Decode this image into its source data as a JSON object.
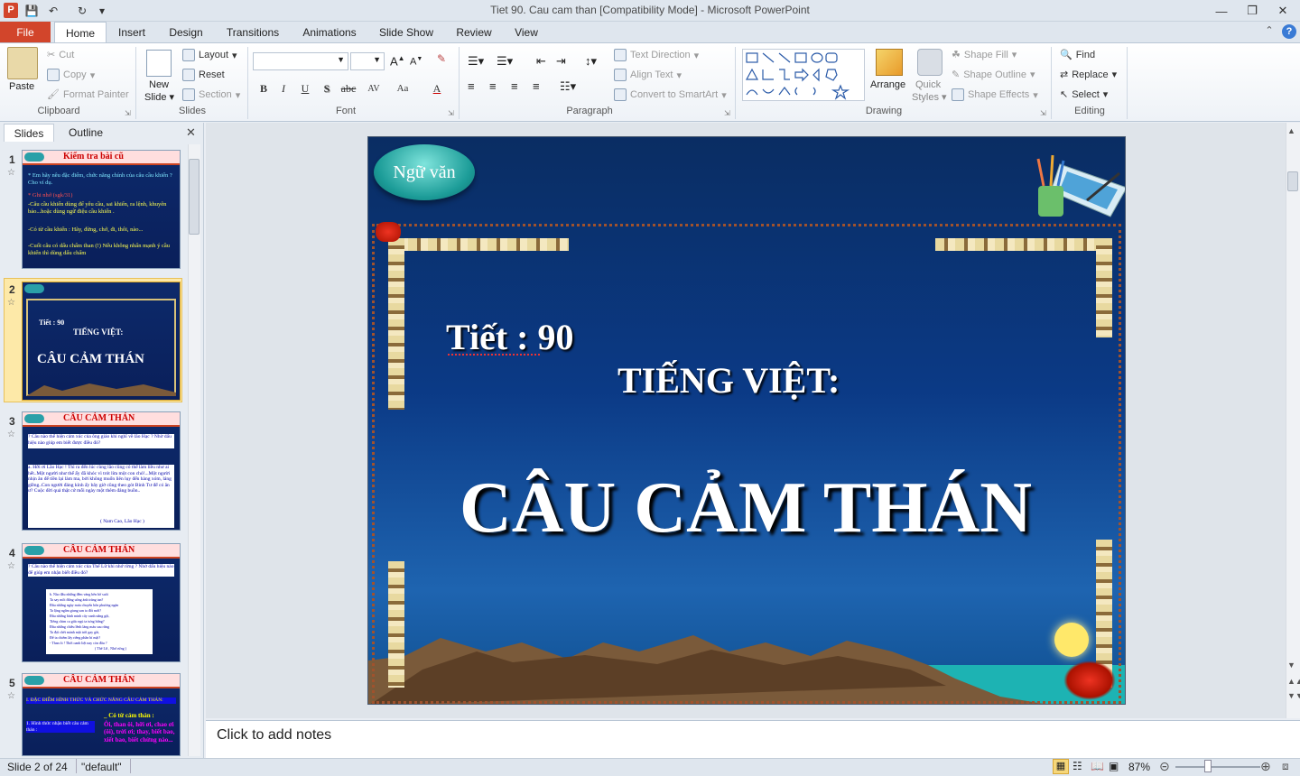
{
  "window": {
    "title": "Tiet 90. Cau cam than [Compatibility Mode] - Microsoft PowerPoint"
  },
  "ribbon_tabs": [
    "File",
    "Home",
    "Insert",
    "Design",
    "Transitions",
    "Animations",
    "Slide Show",
    "Review",
    "View"
  ],
  "clipboard": {
    "paste": "Paste",
    "cut": "Cut",
    "copy": "Copy",
    "format_painter": "Format Painter",
    "label": "Clipboard"
  },
  "slides_group": {
    "new_slide": "New",
    "new_slide2": "Slide",
    "layout": "Layout",
    "reset": "Reset",
    "section": "Section",
    "label": "Slides"
  },
  "font_group": {
    "label": "Font",
    "bold": "B",
    "italic": "I",
    "underline": "U",
    "shadow": "S",
    "strike": "abc",
    "spacing": "AV",
    "case": "Aa",
    "color": "A"
  },
  "paragraph_group": {
    "label": "Paragraph",
    "text_direction": "Text Direction",
    "align_text": "Align Text",
    "convert": "Convert to SmartArt"
  },
  "drawing_group": {
    "label": "Drawing",
    "arrange": "Arrange",
    "quick": "Quick",
    "styles": "Styles",
    "shape_fill": "Shape Fill",
    "shape_outline": "Shape Outline",
    "shape_effects": "Shape Effects"
  },
  "editing_group": {
    "label": "Editing",
    "find": "Find",
    "replace": "Replace",
    "select": "Select"
  },
  "panel_tabs": {
    "slides": "Slides",
    "outline": "Outline"
  },
  "thumbnails": [
    {
      "num": "1",
      "title": "Kiểm tra bài cũ",
      "lines": [
        "* Em hãy nêu đặc điểm, chức năng chính của câu cầu khiến ? Cho ví dụ.",
        "* Ghi nhớ (sgk/31)",
        "-Câu cầu khiến dùng để yêu cầu, sai khiến, ra lệnh, khuyên bảo...hoặc dùng ngữ điệu cầu khiến .",
        "-Có từ cầu khiến : Hãy, đừng, chớ, đi, thôi, nào...",
        "-Cuối câu có dấu chấm than (!) Nếu không nhấn mạnh ý cầu khiến thì dùng dấu chấm"
      ]
    },
    {
      "num": "2",
      "small": "Tiết : 90",
      "sub": "TIẾNG VIỆT:",
      "big": "CÂU CẢM THÁN"
    },
    {
      "num": "3",
      "title": "CÂU CẢM THÁN",
      "lines": [
        "? Câu nào thể hiện cảm xúc của ông giáo khi nghĩ về lão Hạc ? Nhờ dấu hiệu nào giúp em biết được điều đó?",
        "a. Hỡi ơi Lão Hạc ! Thì ra đến lúc cùng lão cũng có thể làm liều như ai hết..Một người như thế ấy đã khóc vì trót lừa một con chó!...Một người nhịn ăn để tiền lại làm ma, bởi không muốn liên lụy đến hàng xóm, láng giềng..Con người đáng kính ấy bây giờ cũng theo gót Binh Tư để có ăn ư? Cuộc đời quả thật cứ mỗi ngày một thêm đáng buồn..",
        "( Nam Cao, Lão Hạc )"
      ]
    },
    {
      "num": "4",
      "title": "CÂU CẢM THÁN",
      "lines": [
        "? Câu nào thể hiện cảm xúc của Thế Lữ khi nhớ rừng ? Nhờ dấu hiệu nào để giúp em nhận biết điều đó?",
        "b. Nào đâu những đêm vàng bên bờ suối",
        "Ta say mồi đứng uống ánh trăng tan?",
        "Đâu những ngày mưa chuyển bốn phương ngàn",
        "Ta lặng ngắm giang san ta đổi mới?",
        "Đâu những bình minh cây xanh nắng gội,",
        "Tiếng chim ca giấc ngủ ta tưng bừng?",
        "Đâu những chiều lênh láng máu sau rừng",
        "Ta đợi chết mảnh mặt trời gay gắt,",
        "Để ta chiếm lấy riêng phần bí mật?",
        "- Than ôi ! Thời oanh liệt nay còn đâu ?",
        "( Thế Lữ , Nhớ rừng )"
      ]
    },
    {
      "num": "5",
      "title": "CÂU CẢM THÁN",
      "lines": [
        "I. ĐẶC ĐIỂM HÌNH THỨC VÀ CHỨC NĂNG CÂU CẢM THÁN:",
        "1. Hình thức nhận biết câu cảm thán :",
        "_ Có từ cảm thán :",
        "Ôi, than ôi, hỡi ơi, chao ơi (ôi), trời ơi; thay, biết bao, xiết bao, biết chừng nào..."
      ]
    }
  ],
  "slide": {
    "badge": "Ngữ văn",
    "lesson": "Tiết : 90",
    "subject": "TIẾNG VIỆT:",
    "heading": "CÂU CẢM THÁN"
  },
  "notes_placeholder": "Click to add notes",
  "status": {
    "slide": "Slide 2 of 24",
    "theme": "\"default\"",
    "zoom": "87%"
  },
  "colors": {
    "file_tab": "#d2452b",
    "slide_bg": "#0b3a86",
    "accent": "#2aa0a8"
  }
}
